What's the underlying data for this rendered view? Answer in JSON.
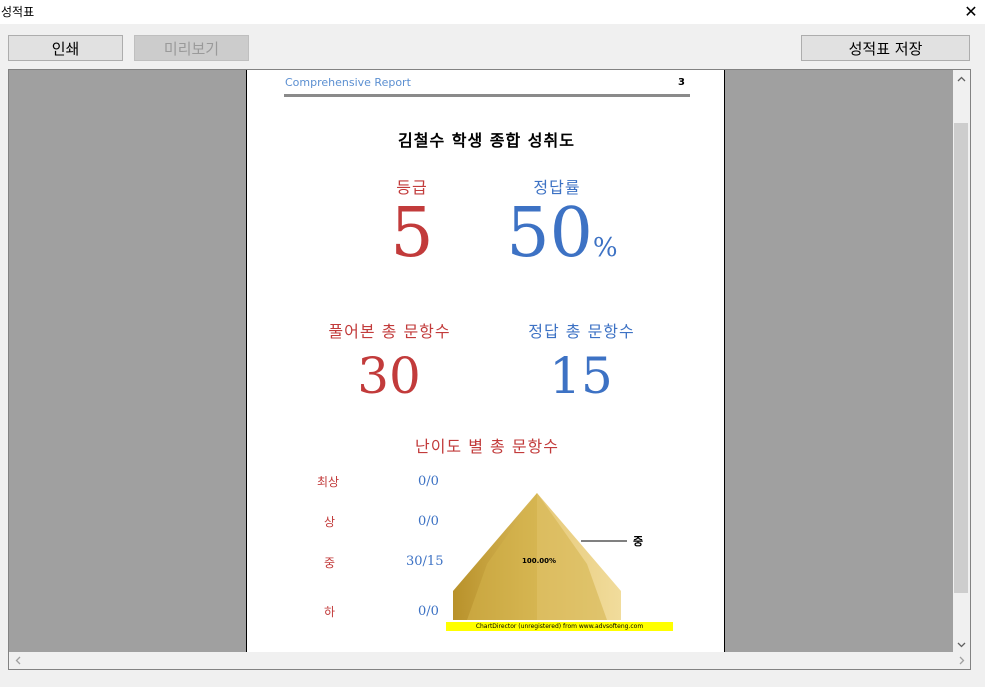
{
  "window": {
    "title": "성적표",
    "close_glyph": "✕"
  },
  "toolbar": {
    "print_label": "인쇄",
    "preview_label": "미리보기",
    "save_label": "성적표 저장"
  },
  "report": {
    "header_left": "Comprehensive Report",
    "page_number": "3",
    "title": "김철수 학생 종합 성취도",
    "grade_label": "등급",
    "grade_value": "5",
    "rate_label": "정답률",
    "rate_value": "50",
    "rate_unit": "%",
    "solved_label": "풀어본 총 문항수",
    "solved_value": "30",
    "correct_label": "정답 총 문항수",
    "correct_value": "15",
    "difficulty_title": "난이도 별 총 문항수",
    "difficulty_rows": [
      {
        "label": "최상",
        "value": "0/0"
      },
      {
        "label": "상",
        "value": "0/0"
      },
      {
        "label": "중",
        "value": "30/15"
      },
      {
        "label": "하",
        "value": "0/0"
      }
    ],
    "pyramid": {
      "segment_label": "중",
      "segment_percent": "100.00%",
      "watermark": "ChartDirector (unregistered) from www.advsofteng.com"
    }
  },
  "colors": {
    "label_red": "#c23b3b",
    "value_blue": "#3d72c4",
    "pyramid_gold": "#c9a23a"
  },
  "icons": {
    "close": "close-icon",
    "scroll_up": "chevron-up-icon",
    "scroll_down": "chevron-down-icon",
    "scroll_left": "chevron-left-icon",
    "scroll_right": "chevron-right-icon"
  }
}
